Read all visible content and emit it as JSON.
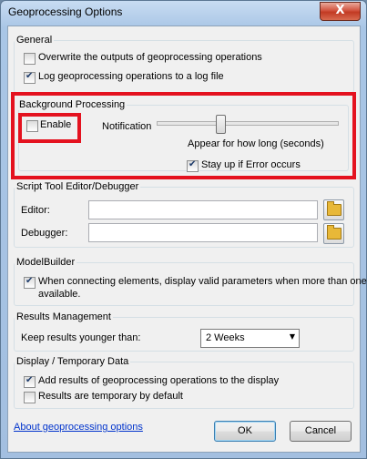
{
  "window": {
    "title": "Geoprocessing Options",
    "close_glyph": "X"
  },
  "general": {
    "heading": "General",
    "overwrite": {
      "label": "Overwrite the outputs of geoprocessing operations",
      "checked": false
    },
    "log": {
      "label": "Log geoprocessing operations to a log file",
      "checked": true
    }
  },
  "background": {
    "heading": "Background Processing",
    "enable": {
      "label": "Enable",
      "checked": false
    },
    "notification_label": "Notification",
    "slider_caption": "Appear for how long (seconds)",
    "stay_up": {
      "label": "Stay up if Error occurs",
      "checked": true
    }
  },
  "script_tool": {
    "heading": "Script Tool Editor/Debugger",
    "editor_label": "Editor:",
    "editor_value": "",
    "debugger_label": "Debugger:",
    "debugger_value": ""
  },
  "modelbuilder": {
    "heading": "ModelBuilder",
    "valid_params": {
      "label_line1": "When connecting elements, display valid parameters when more than one is",
      "label_line2": "available.",
      "checked": true
    }
  },
  "results": {
    "heading": "Results Management",
    "keep_label": "Keep results younger than:",
    "keep_value": "2 Weeks"
  },
  "display": {
    "heading": "Display / Temporary Data",
    "add_results": {
      "label": "Add results of geoprocessing operations to the display",
      "checked": true
    },
    "temporary": {
      "label": "Results are temporary by default",
      "checked": false
    }
  },
  "footer": {
    "about_link": "About geoprocessing options",
    "ok_label": "OK",
    "cancel_label": "Cancel"
  },
  "colors": {
    "highlight_box": "#e4121f",
    "link": "#0033cc"
  }
}
